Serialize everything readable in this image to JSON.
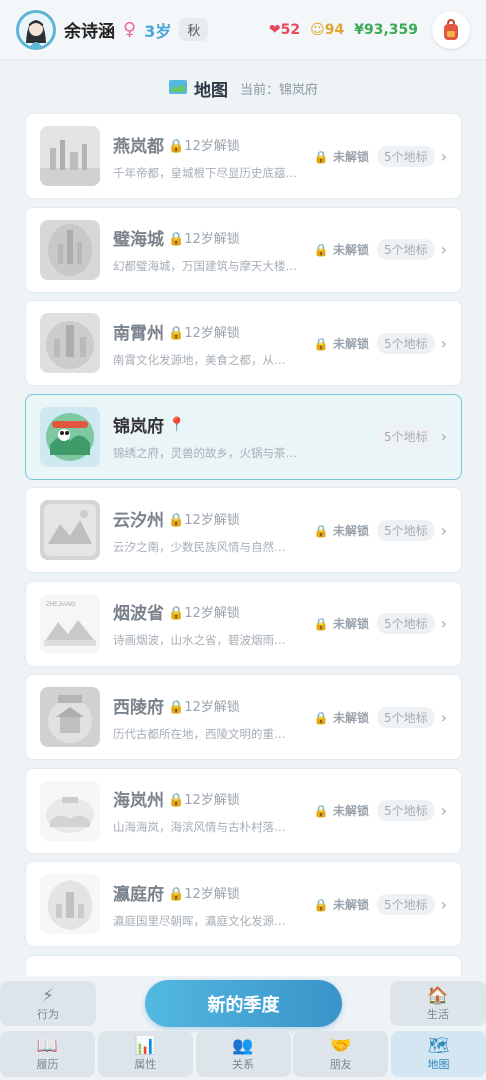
{
  "profile": {
    "name": "余诗涵",
    "gender_symbol": "♀",
    "age": "3岁",
    "season": "秋"
  },
  "stats": {
    "hp": "52",
    "coins": "94",
    "money": "¥93,359"
  },
  "map": {
    "title": "地图",
    "current_label": "当前：锦岚府"
  },
  "cities": [
    {
      "name": "燕岚都",
      "lock": "12岁解锁",
      "desc": "千年帝都，皇城根下尽显历史底蕴…",
      "status": "未解锁",
      "count": "5个地标",
      "locked": true
    },
    {
      "name": "璧海城",
      "lock": "12岁解锁",
      "desc": "幻都璧海城，万国建筑与摩天大楼…",
      "status": "未解锁",
      "count": "5个地标",
      "locked": true
    },
    {
      "name": "南霄州",
      "lock": "12岁解锁",
      "desc": "南霄文化发源地，美食之都，从…",
      "status": "未解锁",
      "count": "5个地标",
      "locked": true
    },
    {
      "name": "锦岚府",
      "lock": "",
      "desc": "锦绣之府，灵兽的故乡，火锅与茶馆，悠闲…",
      "status": "",
      "count": "5个地标",
      "locked": false
    },
    {
      "name": "云汐州",
      "lock": "12岁解锁",
      "desc": "云汐之南，少数民族风情与自然…",
      "status": "未解锁",
      "count": "5个地标",
      "locked": true
    },
    {
      "name": "烟波省",
      "lock": "12岁解锁",
      "desc": "诗画烟波，山水之省，碧波烟雨…",
      "status": "未解锁",
      "count": "5个地标",
      "locked": true
    },
    {
      "name": "西陵府",
      "lock": "12岁解锁",
      "desc": "历代古都所在地，西陵文明的重…",
      "status": "未解锁",
      "count": "5个地标",
      "locked": true
    },
    {
      "name": "海岚州",
      "lock": "12岁解锁",
      "desc": "山海海岚，海滨风情与古朴村落…",
      "status": "未解锁",
      "count": "5个地标",
      "locked": true
    },
    {
      "name": "瀛庭府",
      "lock": "12岁解锁",
      "desc": "瀛庭国里尽朝晖，瀛庭文化发源…",
      "status": "未解锁",
      "count": "5个地标",
      "locked": true
    }
  ],
  "thumb_text": {
    "yanbo": "ZHEJIANG"
  },
  "actions": {
    "action_label": "行为",
    "season_button": "新的季度",
    "life_label": "生活"
  },
  "nav": [
    {
      "label": "履历",
      "icon": "book-icon"
    },
    {
      "label": "属性",
      "icon": "chart-icon"
    },
    {
      "label": "关系",
      "icon": "people-icon"
    },
    {
      "label": "朋友",
      "icon": "handshake-icon"
    },
    {
      "label": "地图",
      "icon": "map-icon"
    }
  ],
  "colors": {
    "accent": "#3a93c9",
    "hp": "#e24b5b",
    "coin": "#e3a72f",
    "money": "#3eaa57"
  }
}
